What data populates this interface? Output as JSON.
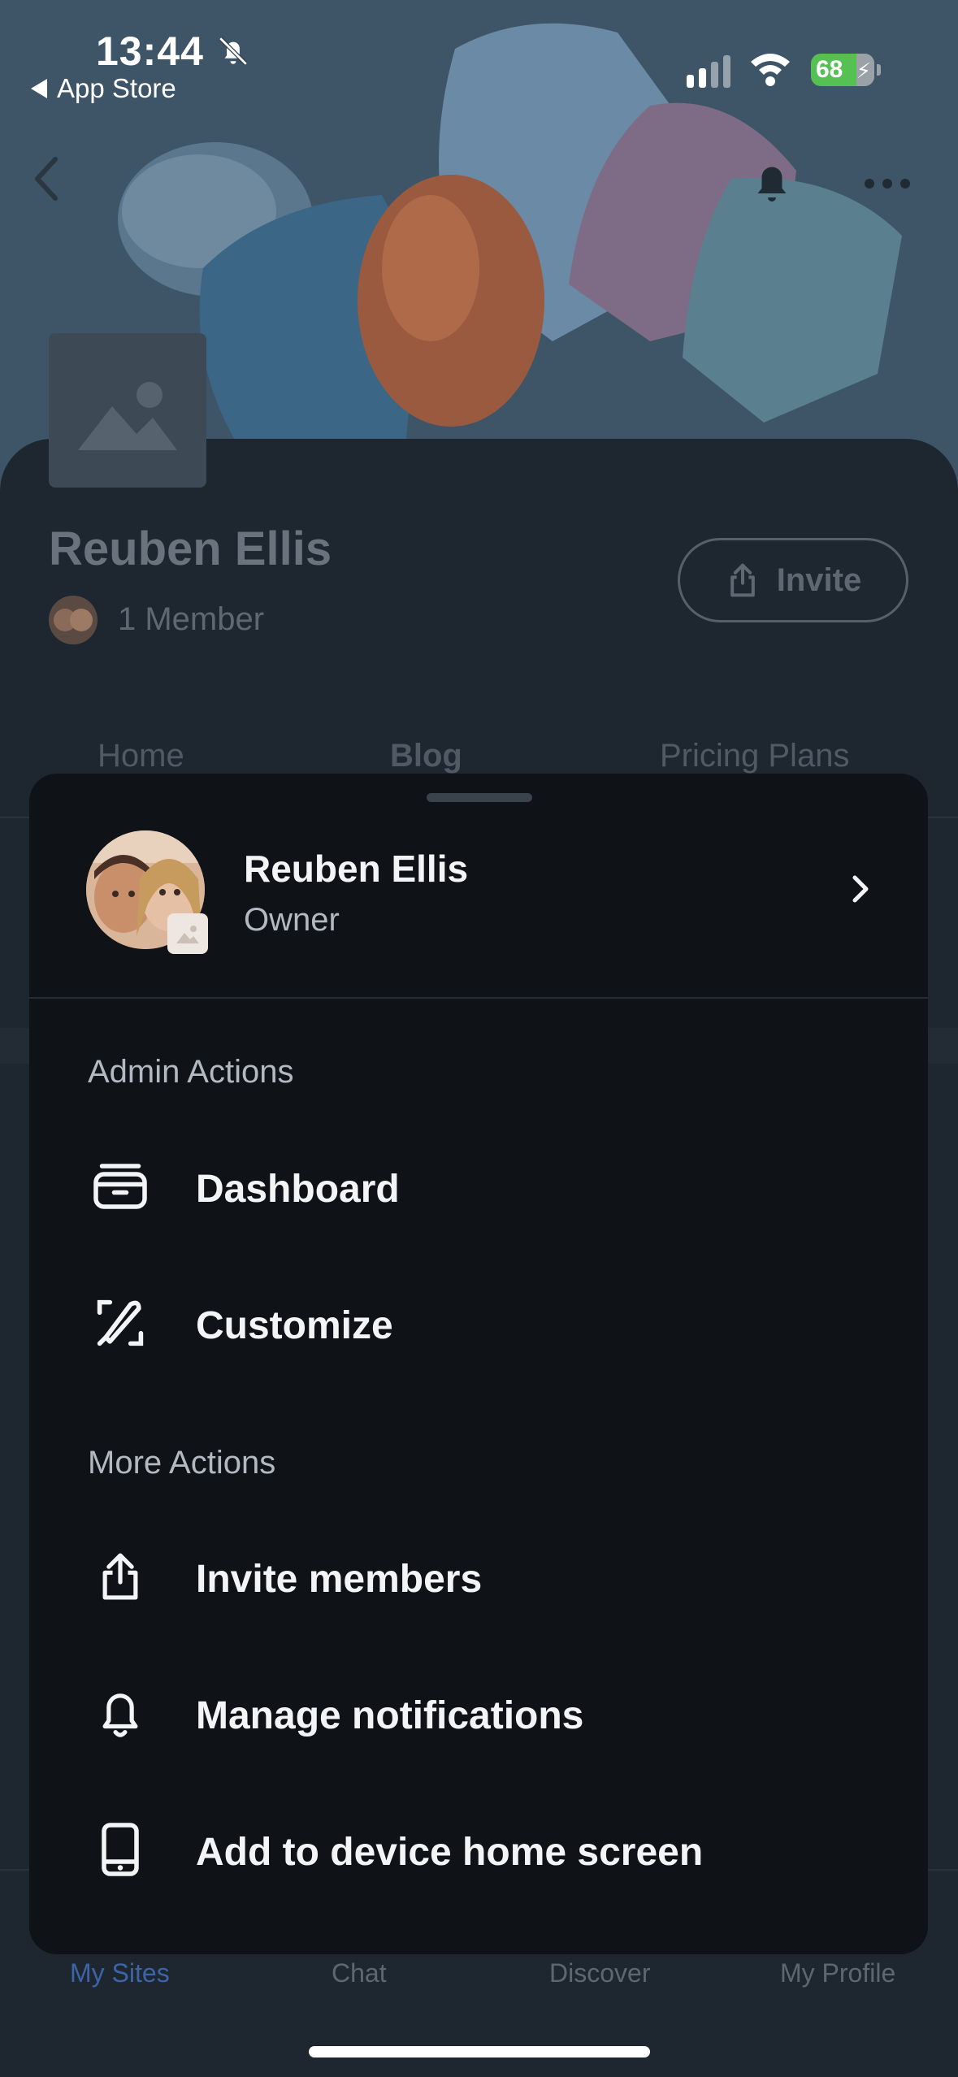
{
  "status_bar": {
    "time": "13:44",
    "back_app": "App Store",
    "battery": "68"
  },
  "site": {
    "name": "Reuben Ellis",
    "members": "1 Member",
    "invite_label": "Invite",
    "tabs": [
      "Home",
      "Blog",
      "Pricing Plans"
    ],
    "active_tab": "Blog"
  },
  "sheet": {
    "owner": {
      "name": "Reuben Ellis",
      "role": "Owner"
    },
    "sections": [
      {
        "label": "Admin Actions",
        "items": [
          {
            "label": "Dashboard",
            "icon": "dashboard-icon"
          },
          {
            "label": "Customize",
            "icon": "customize-icon"
          }
        ]
      },
      {
        "label": "More Actions",
        "items": [
          {
            "label": "Invite members",
            "icon": "share-icon"
          },
          {
            "label": "Manage notifications",
            "icon": "bell-icon"
          },
          {
            "label": "Add to device home screen",
            "icon": "phone-icon"
          }
        ]
      }
    ]
  },
  "bottom_nav": {
    "items": [
      "My Sites",
      "Chat",
      "Discover",
      "My Profile"
    ],
    "active": "My Sites"
  },
  "colors": {
    "sheet_bg": "#0f1318",
    "page_bg": "#1e2730",
    "accent": "#3c64a6",
    "battery_green": "#55c153"
  }
}
